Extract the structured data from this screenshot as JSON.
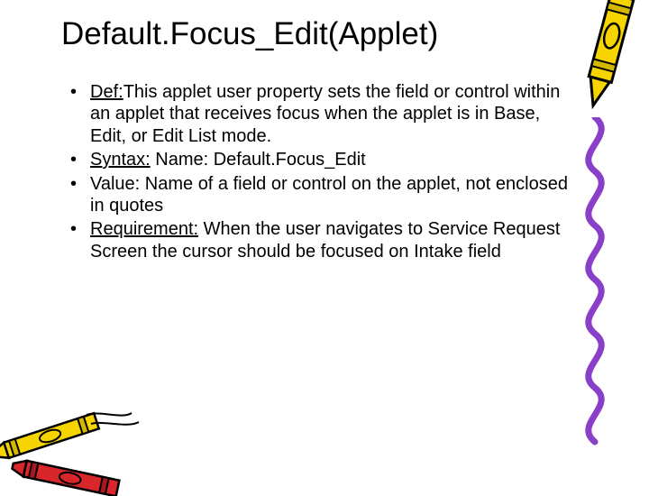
{
  "title": "Default.Focus_Edit(Applet)",
  "bullets": [
    {
      "label": "Def:",
      "text": "This applet user property sets the field or control within an applet that receives focus when the applet is in Base, Edit, or Edit List mode."
    },
    {
      "label": "Syntax:",
      "text": " Name: Default.Focus_Edit"
    },
    {
      "label": "",
      "text": "Value: Name of a field or control on the applet, not enclosed in quotes"
    },
    {
      "label": "Requirement:",
      "text": " When the user navigates to Service Request Screen the cursor should be focused on Intake field"
    }
  ]
}
